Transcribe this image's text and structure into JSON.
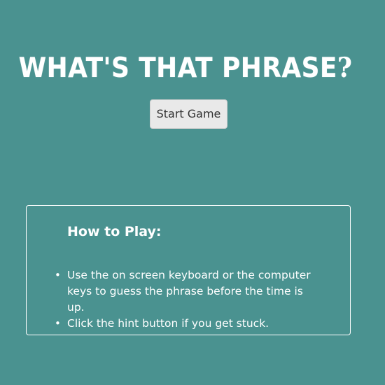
{
  "title": {
    "text": "WHAT'S THAT PHRASE",
    "question_mark": "?"
  },
  "start_button": {
    "label": "Start Game"
  },
  "howto": {
    "heading": "How to Play:",
    "items": [
      "Use the on screen keyboard or the computer keys to guess the phrase before the time is up.",
      "Click the hint button if you get stuck."
    ],
    "bullet": "•"
  },
  "colors": {
    "background": "#4a9290",
    "text": "#ffffff",
    "button_bg": "#e9e9e9",
    "button_text": "#333333"
  }
}
